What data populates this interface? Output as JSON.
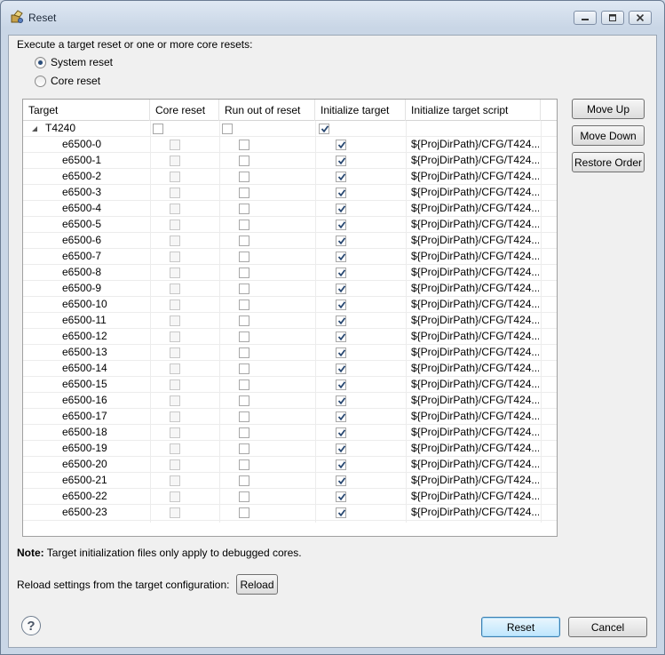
{
  "window": {
    "title": "Reset"
  },
  "instructions": "Execute a target reset or one or more core resets:",
  "options": {
    "system_reset": "System reset",
    "core_reset": "Core reset",
    "selected": "system_reset"
  },
  "table": {
    "columns": [
      "Target",
      "Core reset",
      "Run out of reset",
      "Initialize target",
      "Initialize target script"
    ],
    "group": {
      "name": "T4240",
      "core_reset": false,
      "run_out": false,
      "init": true,
      "script": ""
    },
    "rows": [
      {
        "target": "e6500-0",
        "core_reset": false,
        "run_out": false,
        "init": true,
        "script": "${ProjDirPath}/CFG/T424..."
      },
      {
        "target": "e6500-1",
        "core_reset": false,
        "run_out": false,
        "init": true,
        "script": "${ProjDirPath}/CFG/T424..."
      },
      {
        "target": "e6500-2",
        "core_reset": false,
        "run_out": false,
        "init": true,
        "script": "${ProjDirPath}/CFG/T424..."
      },
      {
        "target": "e6500-3",
        "core_reset": false,
        "run_out": false,
        "init": true,
        "script": "${ProjDirPath}/CFG/T424..."
      },
      {
        "target": "e6500-4",
        "core_reset": false,
        "run_out": false,
        "init": true,
        "script": "${ProjDirPath}/CFG/T424..."
      },
      {
        "target": "e6500-5",
        "core_reset": false,
        "run_out": false,
        "init": true,
        "script": "${ProjDirPath}/CFG/T424..."
      },
      {
        "target": "e6500-6",
        "core_reset": false,
        "run_out": false,
        "init": true,
        "script": "${ProjDirPath}/CFG/T424..."
      },
      {
        "target": "e6500-7",
        "core_reset": false,
        "run_out": false,
        "init": true,
        "script": "${ProjDirPath}/CFG/T424..."
      },
      {
        "target": "e6500-8",
        "core_reset": false,
        "run_out": false,
        "init": true,
        "script": "${ProjDirPath}/CFG/T424..."
      },
      {
        "target": "e6500-9",
        "core_reset": false,
        "run_out": false,
        "init": true,
        "script": "${ProjDirPath}/CFG/T424..."
      },
      {
        "target": "e6500-10",
        "core_reset": false,
        "run_out": false,
        "init": true,
        "script": "${ProjDirPath}/CFG/T424..."
      },
      {
        "target": "e6500-11",
        "core_reset": false,
        "run_out": false,
        "init": true,
        "script": "${ProjDirPath}/CFG/T424..."
      },
      {
        "target": "e6500-12",
        "core_reset": false,
        "run_out": false,
        "init": true,
        "script": "${ProjDirPath}/CFG/T424..."
      },
      {
        "target": "e6500-13",
        "core_reset": false,
        "run_out": false,
        "init": true,
        "script": "${ProjDirPath}/CFG/T424..."
      },
      {
        "target": "e6500-14",
        "core_reset": false,
        "run_out": false,
        "init": true,
        "script": "${ProjDirPath}/CFG/T424..."
      },
      {
        "target": "e6500-15",
        "core_reset": false,
        "run_out": false,
        "init": true,
        "script": "${ProjDirPath}/CFG/T424..."
      },
      {
        "target": "e6500-16",
        "core_reset": false,
        "run_out": false,
        "init": true,
        "script": "${ProjDirPath}/CFG/T424..."
      },
      {
        "target": "e6500-17",
        "core_reset": false,
        "run_out": false,
        "init": true,
        "script": "${ProjDirPath}/CFG/T424..."
      },
      {
        "target": "e6500-18",
        "core_reset": false,
        "run_out": false,
        "init": true,
        "script": "${ProjDirPath}/CFG/T424..."
      },
      {
        "target": "e6500-19",
        "core_reset": false,
        "run_out": false,
        "init": true,
        "script": "${ProjDirPath}/CFG/T424..."
      },
      {
        "target": "e6500-20",
        "core_reset": false,
        "run_out": false,
        "init": true,
        "script": "${ProjDirPath}/CFG/T424..."
      },
      {
        "target": "e6500-21",
        "core_reset": false,
        "run_out": false,
        "init": true,
        "script": "${ProjDirPath}/CFG/T424..."
      },
      {
        "target": "e6500-22",
        "core_reset": false,
        "run_out": false,
        "init": true,
        "script": "${ProjDirPath}/CFG/T424..."
      },
      {
        "target": "e6500-23",
        "core_reset": false,
        "run_out": false,
        "init": true,
        "script": "${ProjDirPath}/CFG/T424..."
      }
    ]
  },
  "side_buttons": {
    "move_up": "Move Up",
    "move_down": "Move Down",
    "restore_order": "Restore Order"
  },
  "note": {
    "label": "Note:",
    "text": "Target initialization files only apply to debugged cores."
  },
  "reload": {
    "label": "Reload settings from the target configuration:",
    "button": "Reload"
  },
  "footer": {
    "help": "?",
    "reset": "Reset",
    "cancel": "Cancel"
  }
}
